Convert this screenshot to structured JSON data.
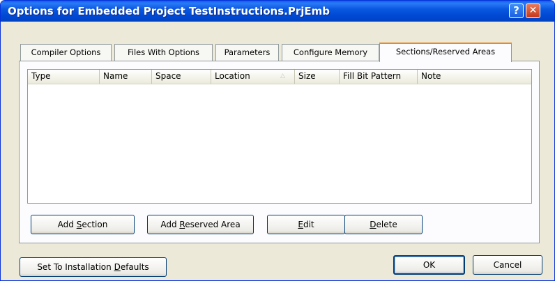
{
  "window": {
    "title": "Options for Embedded Project TestInstructions.PrjEmb",
    "help_glyph": "?",
    "close_glyph": "✕"
  },
  "tabs": [
    {
      "label": "Compiler Options"
    },
    {
      "label": "Files With Options"
    },
    {
      "label": "Parameters"
    },
    {
      "label": "Configure Memory"
    },
    {
      "label": "Sections/Reserved Areas",
      "active": true
    }
  ],
  "list": {
    "columns": [
      "Type",
      "Name",
      "Space",
      "Location",
      "Size",
      "Fill Bit Pattern",
      "Note"
    ],
    "sorted_column": "Location",
    "sort_indicator": "△",
    "rows": []
  },
  "panel_buttons": {
    "add_section": {
      "pre": "Add ",
      "key": "S",
      "post": "ection"
    },
    "add_reserved": {
      "pre": "Add ",
      "key": "R",
      "post": "eserved Area"
    },
    "edit": {
      "pre": "",
      "key": "E",
      "post": "dit"
    },
    "delete": {
      "pre": "",
      "key": "D",
      "post": "elete"
    }
  },
  "footer": {
    "defaults": {
      "pre": "Set To Installation ",
      "key": "D",
      "post": "efaults"
    },
    "ok": "OK",
    "cancel": "Cancel"
  }
}
